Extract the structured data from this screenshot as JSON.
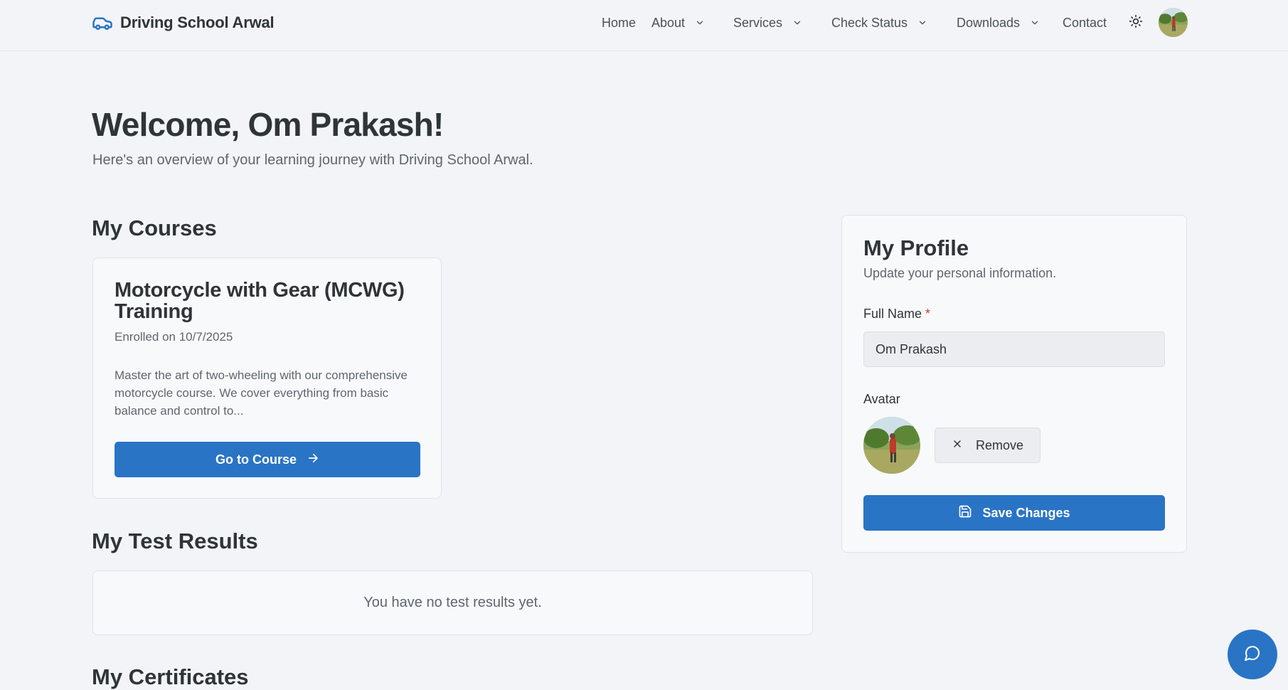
{
  "header": {
    "brand": "Driving School Arwal",
    "nav": {
      "home": "Home",
      "about": "About",
      "services": "Services",
      "check_status": "Check Status",
      "downloads": "Downloads",
      "contact": "Contact"
    }
  },
  "hero": {
    "title": "Welcome, Om Prakash!",
    "subtitle": "Here's an overview of your learning journey with Driving School Arwal."
  },
  "courses": {
    "heading": "My Courses",
    "items": [
      {
        "title": "Motorcycle with Gear (MCWG) Training",
        "enrolled": "Enrolled on 10/7/2025",
        "description": "Master the art of two-wheeling with our comprehensive motorcycle course. We cover everything from basic balance and control to...",
        "button": "Go to Course"
      }
    ]
  },
  "test_results": {
    "heading": "My Test Results",
    "empty": "You have no test results yet."
  },
  "certificates": {
    "heading": "My Certificates"
  },
  "profile": {
    "title": "My Profile",
    "subtitle": "Update your personal information.",
    "full_name_label": "Full Name",
    "required_mark": "*",
    "full_name_value": "Om Prakash",
    "avatar_label": "Avatar",
    "remove_button": "Remove",
    "save_button": "Save Changes"
  },
  "colors": {
    "accent": "#2a74c5",
    "background": "#f2f4f7",
    "required": "#d9352e"
  }
}
